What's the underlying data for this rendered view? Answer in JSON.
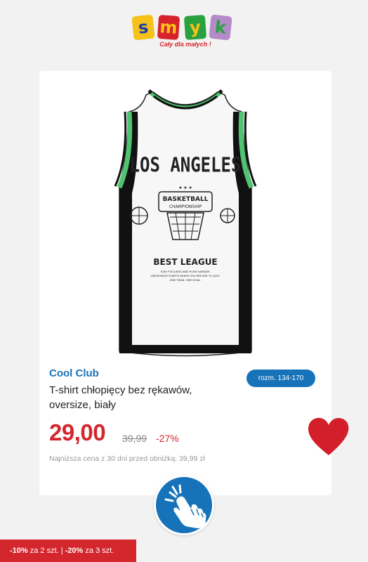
{
  "logo": {
    "letters": [
      "s",
      "m",
      "y",
      "k"
    ],
    "letter_colors": [
      "#f6c21a",
      "#d6232b",
      "#2aa13f",
      "#d9c52a"
    ],
    "tagline": "Cały dla małych !"
  },
  "product": {
    "brand": "Cool Club",
    "size": "rozm. 134-170",
    "name": "T-shirt chłopięcy bez rękawów, oversize, biały",
    "price": "29,00",
    "old_price": "39,99",
    "discount": "-27%",
    "lowest_price_note": "Najniższa cena z 30 dni przed obniżką: 39,99 zł",
    "image": {
      "headline": "LOS ANGELES",
      "badge_line1": "BASKETBALL",
      "badge_line2": "CHAMPIONSHIP",
      "stars": "★ ★ ★",
      "subhead": "BEST LEAGUE",
      "small_text_1": "STAY FOCUSED AND PUSH HARDER.",
      "small_text_2": "GREATNESS STARTS WHEN YOU REFUSE TO QUIT.",
      "small_text_3": "ONE TEAM. ONE GOAL."
    }
  },
  "promo": {
    "part1_bold": "-10%",
    "part1": "za 2 szt.",
    "separator": "|",
    "part2_bold": "-20%",
    "part2": "za 3 szt."
  },
  "colors": {
    "accent_blue": "#1673b9",
    "accent_red": "#d4262d",
    "green_stripe": "#4fc36f"
  },
  "icons": {
    "heart": "heart-icon",
    "tap": "hand-tap-icon"
  }
}
